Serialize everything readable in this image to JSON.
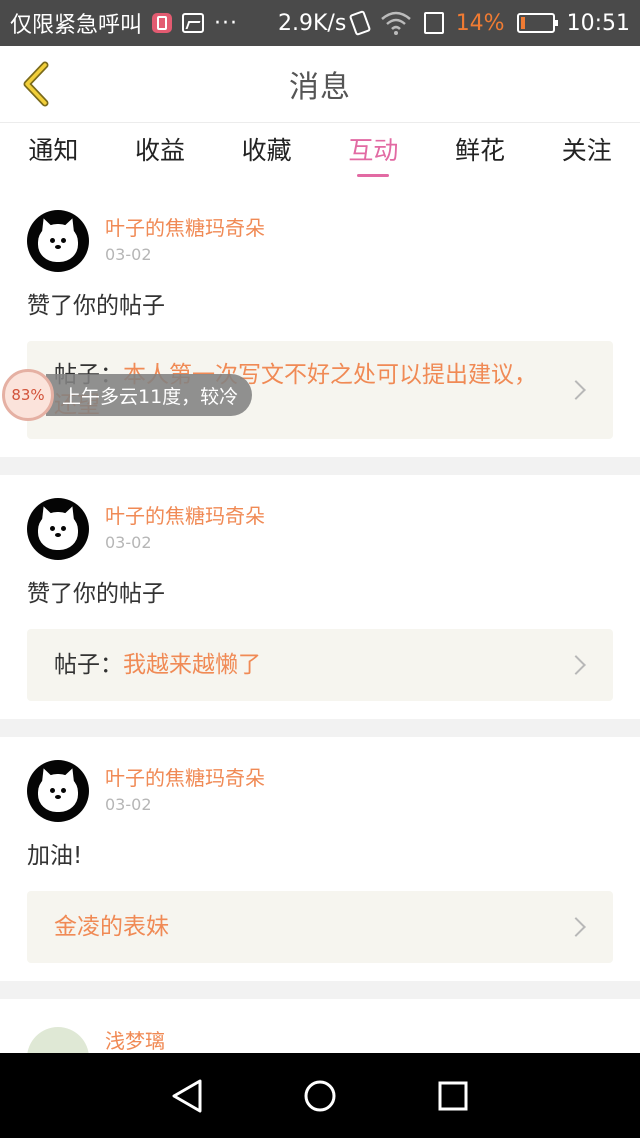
{
  "status_bar": {
    "carrier": "仅限紧急呼叫",
    "notification_dots": "···",
    "speed": "2.9K/s",
    "battery_percent": "14%",
    "battery_level": 0.14,
    "time": "10:51"
  },
  "header": {
    "title": "消息",
    "back_icon": "chevron-left-icon"
  },
  "tabs": [
    {
      "label": "通知",
      "active": false
    },
    {
      "label": "收益",
      "active": false
    },
    {
      "label": "收藏",
      "active": false
    },
    {
      "label": "互动",
      "active": true
    },
    {
      "label": "鲜花",
      "active": false
    },
    {
      "label": "关注",
      "active": false
    }
  ],
  "colors": {
    "accent_pink": "#e26aa3",
    "username_orange": "#f08a55",
    "battery_orange": "#f07b33"
  },
  "feed": [
    {
      "username": "叶子的焦糖玛奇朵",
      "time": "03-02",
      "action": "赞了你的帖子",
      "post_prefix": "帖子：",
      "post_title": "本人第一次写文不好之处可以提出建议，还望"
    },
    {
      "username": "叶子的焦糖玛奇朵",
      "time": "03-02",
      "action": "赞了你的帖子",
      "post_prefix": "帖子：",
      "post_title": "我越来越懒了"
    },
    {
      "username": "叶子的焦糖玛奇朵",
      "time": "03-02",
      "action": "加油!",
      "post_prefix": "",
      "post_title": "金凌的表妹"
    },
    {
      "username": "浅梦璃"
    }
  ],
  "weather_widget": {
    "percent": "83%",
    "text": "上午多云11度，较冷"
  }
}
